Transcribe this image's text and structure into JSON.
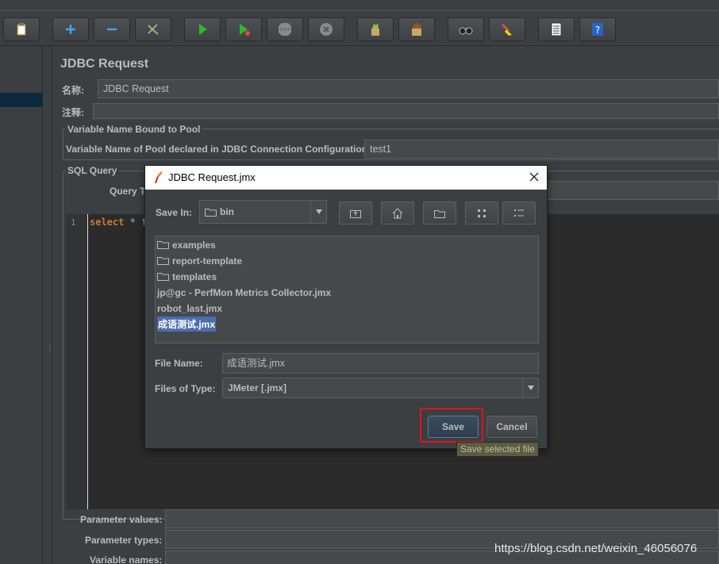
{
  "toolbar": {
    "buttons": [
      {
        "name": "paste-icon"
      },
      {
        "name": "add-icon"
      },
      {
        "name": "remove-icon"
      },
      {
        "name": "toggle-icon"
      },
      {
        "name": "start-icon"
      },
      {
        "name": "start-no-pauses-icon"
      },
      {
        "name": "stop-icon"
      },
      {
        "name": "shutdown-icon"
      },
      {
        "name": "clear-icon"
      },
      {
        "name": "clear-all-icon"
      },
      {
        "name": "search-icon"
      },
      {
        "name": "reset-search-icon"
      },
      {
        "name": "function-helper-icon"
      },
      {
        "name": "help-icon"
      }
    ]
  },
  "panel": {
    "title": "JDBC Request",
    "name_label": "名称:",
    "name_value": "JDBC Request",
    "comment_label": "注释:",
    "comment_value": "",
    "pool_group_title": "Variable Name Bound to Pool",
    "pool_label": "Variable Name of Pool declared in JDBC Connection Configuration:",
    "pool_value": "test1",
    "sql_group_title": "SQL Query",
    "query_type_label": "Query T",
    "editor": {
      "line_number": "1",
      "keyword": "select",
      "code_rest": " * f"
    },
    "param_values_label": "Parameter values:",
    "param_types_label": "Parameter types:",
    "variable_names_label": "Variable names:"
  },
  "dialog": {
    "title": "JDBC Request.jmx",
    "save_in_label": "Save In:",
    "save_in_value": "bin",
    "files": [
      {
        "name": "examples",
        "type": "folder"
      },
      {
        "name": "report-template",
        "type": "folder"
      },
      {
        "name": "templates",
        "type": "folder"
      },
      {
        "name": "jp@gc - PerfMon Metrics Collector.jmx",
        "type": "file"
      },
      {
        "name": "robot_last.jmx",
        "type": "file"
      },
      {
        "name": "成语测试.jmx",
        "type": "file",
        "selected": true
      }
    ],
    "file_name_label": "File Name:",
    "file_name_value": "成语测试.jmx",
    "file_type_label": "Files of Type:",
    "file_type_value": "JMeter [.jmx]",
    "save_label": "Save",
    "cancel_label": "Cancel",
    "tooltip": "Save selected file"
  },
  "watermark": "https://blog.csdn.net/weixin_46056076",
  "colors": {
    "background": "#3c3f41",
    "field": "#45494a",
    "selection": "#4b6eaf",
    "highlight_box": "#e0141e",
    "tooltip_bg": "#5c5d3e"
  }
}
